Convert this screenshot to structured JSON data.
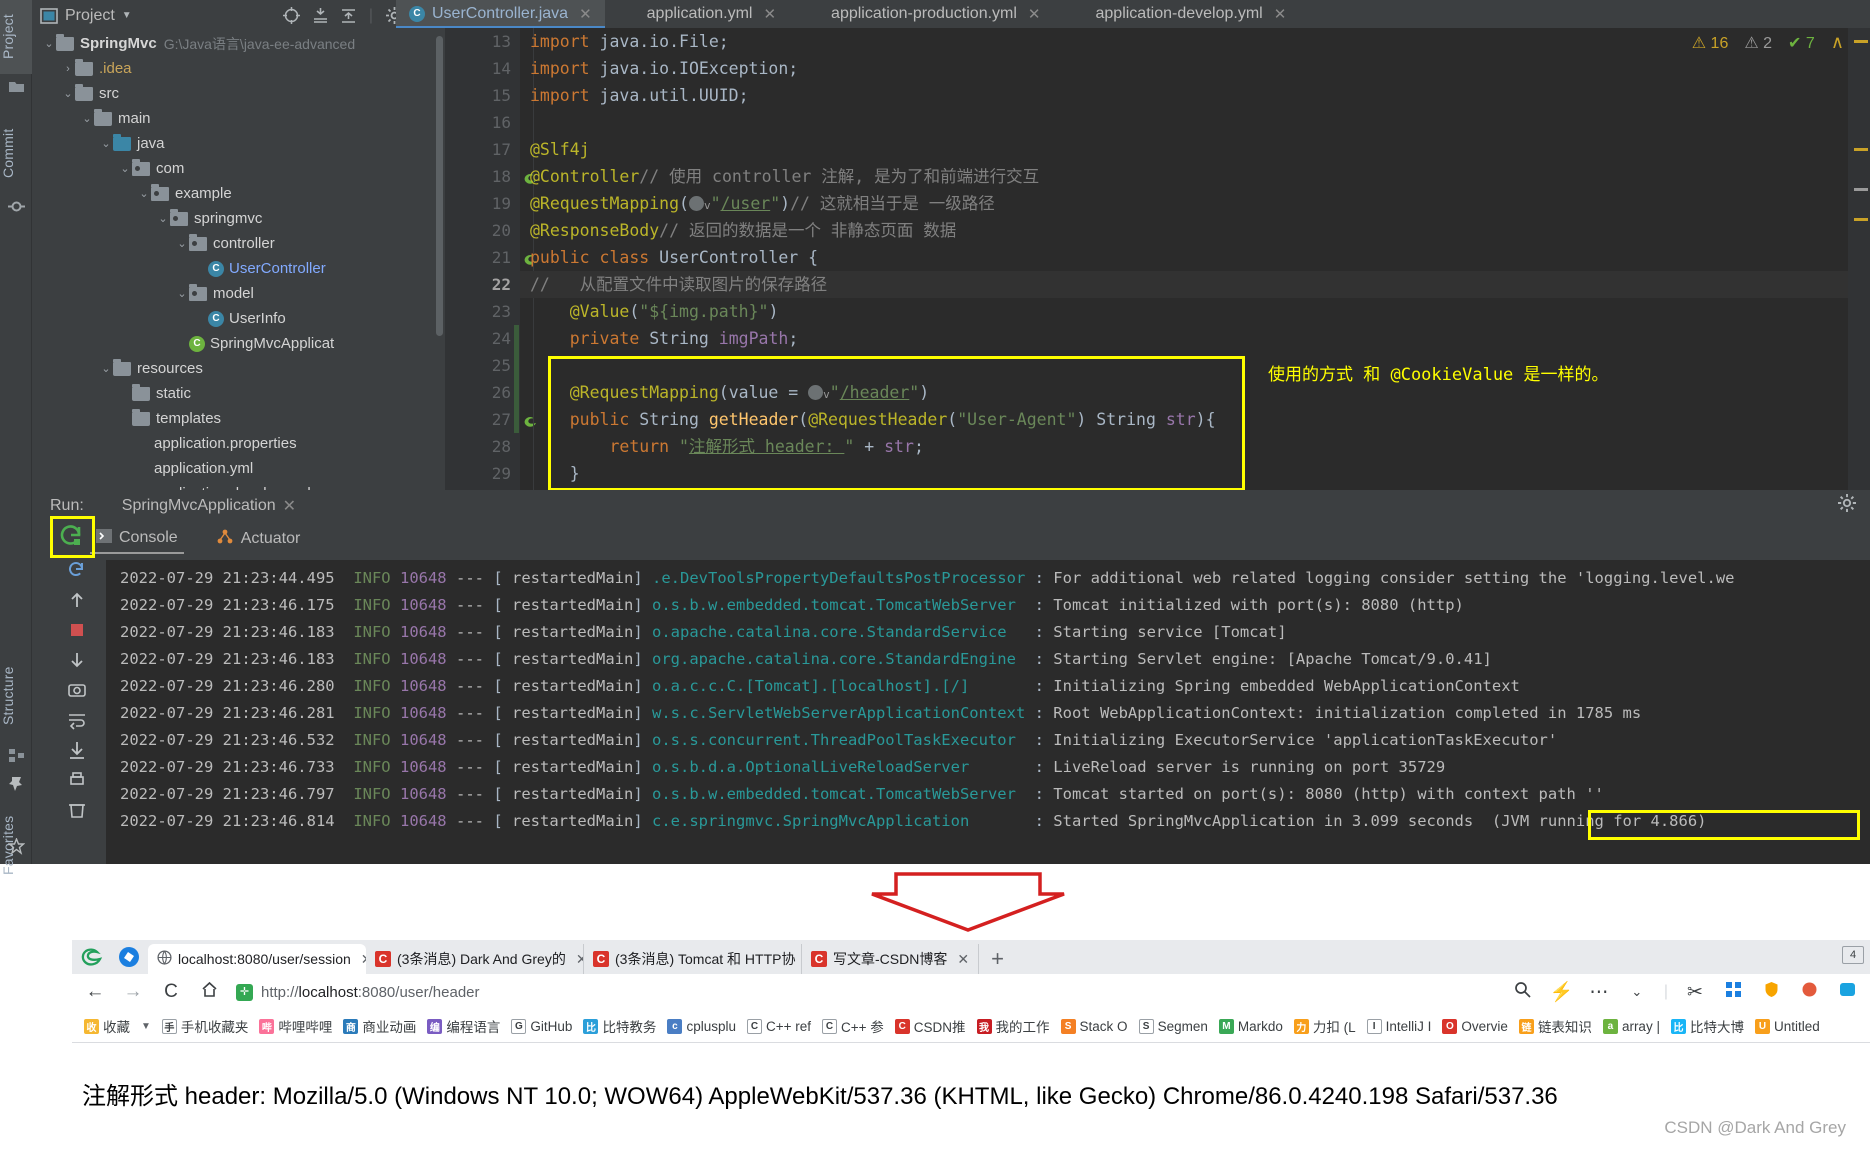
{
  "ide": {
    "left_strip": [
      {
        "label": "Project",
        "name": "tool-window-project",
        "active": true
      },
      {
        "label": "Commit",
        "name": "tool-window-commit",
        "active": false
      },
      {
        "label": "Structure",
        "name": "tool-window-structure",
        "active": false
      },
      {
        "label": "Favorites",
        "name": "tool-window-favorites",
        "active": false
      }
    ],
    "project_panel": {
      "title": "Project",
      "tree": [
        {
          "indent": 0,
          "chev": "v",
          "icon": "folder-module",
          "label": "SpringMvc",
          "bold": true,
          "path": "G:\\Java语言\\java-ee-advanced"
        },
        {
          "indent": 1,
          "chev": ">",
          "icon": "folder",
          "label": ".idea",
          "color": "yellow"
        },
        {
          "indent": 1,
          "chev": "v",
          "icon": "folder",
          "label": "src"
        },
        {
          "indent": 2,
          "chev": "v",
          "icon": "folder",
          "label": "main"
        },
        {
          "indent": 3,
          "chev": "v",
          "icon": "folder-blue",
          "label": "java"
        },
        {
          "indent": 4,
          "chev": "v",
          "icon": "package",
          "label": "com"
        },
        {
          "indent": 5,
          "chev": "v",
          "icon": "package",
          "label": "example"
        },
        {
          "indent": 6,
          "chev": "v",
          "icon": "package",
          "label": "springmvc"
        },
        {
          "indent": 7,
          "chev": "v",
          "icon": "package",
          "label": "controller"
        },
        {
          "indent": 8,
          "chev": "",
          "icon": "class",
          "label": "UserController",
          "color": "blue"
        },
        {
          "indent": 7,
          "chev": "v",
          "icon": "package",
          "label": "model"
        },
        {
          "indent": 8,
          "chev": "",
          "icon": "class",
          "label": "UserInfo"
        },
        {
          "indent": 7,
          "chev": "",
          "icon": "spring-app",
          "label": "SpringMvcApplicat"
        },
        {
          "indent": 3,
          "chev": "v",
          "icon": "folder-res",
          "label": "resources"
        },
        {
          "indent": 4,
          "chev": "",
          "icon": "folder",
          "label": "static"
        },
        {
          "indent": 4,
          "chev": "",
          "icon": "folder",
          "label": "templates"
        },
        {
          "indent": 4,
          "chev": "",
          "icon": "spring-leaf",
          "label": "application.properties"
        },
        {
          "indent": 4,
          "chev": "",
          "icon": "spring-leaf",
          "label": "application.yml"
        },
        {
          "indent": 4,
          "chev": "",
          "icon": "spring-leaf",
          "label": "application-develop.yml"
        }
      ]
    },
    "editor_tabs": [
      {
        "label": "UserController.java",
        "icon": "java-class-icon",
        "active": true
      },
      {
        "label": "application.yml",
        "icon": "spring-leaf-icon",
        "active": false
      },
      {
        "label": "application-production.yml",
        "icon": "spring-leaf-icon",
        "active": false
      },
      {
        "label": "application-develop.yml",
        "icon": "spring-leaf-icon",
        "active": false
      }
    ],
    "inspections": {
      "warnings": "16",
      "weak_warnings": "2",
      "checks": "7"
    },
    "code_lines": [
      {
        "num": "13",
        "marker": "",
        "html": "<span class=\"k\">import</span> java.io.File;",
        "indent": 1
      },
      {
        "num": "14",
        "marker": "",
        "html": "<span class=\"k\">import</span> java.io.IOException;",
        "indent": 1
      },
      {
        "num": "15",
        "marker": "",
        "html": "<span class=\"k\">import</span> java.util.UUID;",
        "indent": 1
      },
      {
        "num": "16",
        "marker": "",
        "html": "",
        "indent": 0
      },
      {
        "num": "17",
        "marker": "",
        "html": "<span class=\"ann\">@Slf4j</span>",
        "indent": 1
      },
      {
        "num": "18",
        "marker": "spring-bean",
        "html": "<span class=\"ann\">@Controller</span><span class=\"cmt\">// 使用 controller 注解, 是为了和前端进行交互</span>",
        "indent": 1
      },
      {
        "num": "19",
        "marker": "",
        "html": "<span class=\"ann\">@RequestMapping</span>(<span class=\"glob\"></span><span class=\"chv\">v</span><span class=\"str\">\"</span><span class=\"lnk\">/user</span><span class=\"str\">\"</span>)<span class=\"cmt\">// 这就相当于是 一级路径</span>",
        "indent": 1
      },
      {
        "num": "20",
        "marker": "",
        "html": "<span class=\"ann\">@ResponseBody</span><span class=\"cmt\">// 返回的数据是一个 非静态页面 数据</span>",
        "indent": 1
      },
      {
        "num": "21",
        "marker": "spring-controller",
        "html": "<span class=\"k\">public class</span> <span class=\"cn\">UserController</span> {",
        "indent": 1
      },
      {
        "num": "22",
        "marker": "",
        "html": "<span class=\"cmt\">//   从配置文件中读取图片的保存路径</span>",
        "indent": 1,
        "highlight": true
      },
      {
        "num": "23",
        "marker": "",
        "html": "    <span class=\"ann\">@Value</span>(<span class=\"str\">\"${img.path}\"</span>)",
        "indent": 1
      },
      {
        "num": "24",
        "marker": "",
        "html": "    <span class=\"k\">private</span> String <span class=\"fld\">imgPath</span>;",
        "indent": 1
      },
      {
        "num": "25",
        "marker": "",
        "html": "",
        "indent": 0
      },
      {
        "num": "26",
        "marker": "",
        "html": "    <span class=\"ann\">@RequestMapping</span>(value = <span class=\"glob\"></span><span class=\"chv\">v</span><span class=\"str\">\"</span><span class=\"lnk\">/header</span><span class=\"str\">\"</span>)",
        "indent": 1
      },
      {
        "num": "27",
        "marker": "spring-controller",
        "html": "    <span class=\"k\">public</span> String <span class=\"mth\">getHeader</span>(<span class=\"ann\">@RequestHeader</span>(<span class=\"str\">\"User-Agent\"</span>) String <span class=\"fld\">str</span>){",
        "indent": 1
      },
      {
        "num": "28",
        "marker": "",
        "html": "        <span class=\"k\">return</span> <span class=\"str\">\"</span><span class=\"lnk\">注解形式 header: </span><span class=\"str\">\"</span> + <span class=\"fld\">str</span>;",
        "indent": 1
      },
      {
        "num": "29",
        "marker": "",
        "html": "    }",
        "indent": 1
      }
    ],
    "editor_note": "使用的方式 和 @CookieValue 是一样的。"
  },
  "run_panel": {
    "run_label": "Run:",
    "config_name": "SpringMvcApplication",
    "tabs": [
      {
        "label": "Console",
        "icon": "console-icon",
        "active": true
      },
      {
        "label": "Actuator",
        "icon": "actuator-icon",
        "active": false
      }
    ],
    "log": [
      {
        "ts": "2022-07-29 21:23:44.495",
        "level": "INFO",
        "pid": "10648",
        "thread": "restartedMain",
        "cls": ".e.DevToolsPropertyDefaultsPostProcessor",
        "msg": "For additional web related logging consider setting the 'logging.level.we"
      },
      {
        "ts": "2022-07-29 21:23:46.175",
        "level": "INFO",
        "pid": "10648",
        "thread": "restartedMain",
        "cls": "o.s.b.w.embedded.tomcat.TomcatWebServer",
        "msg": "Tomcat initialized with port(s): 8080 (http)"
      },
      {
        "ts": "2022-07-29 21:23:46.183",
        "level": "INFO",
        "pid": "10648",
        "thread": "restartedMain",
        "cls": "o.apache.catalina.core.StandardService",
        "msg": "Starting service [Tomcat]"
      },
      {
        "ts": "2022-07-29 21:23:46.183",
        "level": "INFO",
        "pid": "10648",
        "thread": "restartedMain",
        "cls": "org.apache.catalina.core.StandardEngine",
        "msg": "Starting Servlet engine: [Apache Tomcat/9.0.41]"
      },
      {
        "ts": "2022-07-29 21:23:46.280",
        "level": "INFO",
        "pid": "10648",
        "thread": "restartedMain",
        "cls": "o.a.c.c.C.[Tomcat].[localhost].[/]",
        "msg": "Initializing Spring embedded WebApplicationContext"
      },
      {
        "ts": "2022-07-29 21:23:46.281",
        "level": "INFO",
        "pid": "10648",
        "thread": "restartedMain",
        "cls": "w.s.c.ServletWebServerApplicationContext",
        "msg": "Root WebApplicationContext: initialization completed in 1785 ms"
      },
      {
        "ts": "2022-07-29 21:23:46.532",
        "level": "INFO",
        "pid": "10648",
        "thread": "restartedMain",
        "cls": "o.s.s.concurrent.ThreadPoolTaskExecutor",
        "msg": "Initializing ExecutorService 'applicationTaskExecutor'"
      },
      {
        "ts": "2022-07-29 21:23:46.733",
        "level": "INFO",
        "pid": "10648",
        "thread": "restartedMain",
        "cls": "o.s.b.d.a.OptionalLiveReloadServer",
        "msg": "LiveReload server is running on port 35729"
      },
      {
        "ts": "2022-07-29 21:23:46.797",
        "level": "INFO",
        "pid": "10648",
        "thread": "restartedMain",
        "cls": "o.s.b.w.embedded.tomcat.TomcatWebServer",
        "msg": "Tomcat started on port(s): 8080 (http) with context path ''"
      },
      {
        "ts": "2022-07-29 21:23:46.814",
        "level": "INFO",
        "pid": "10648",
        "thread": "restartedMain",
        "cls": "c.e.springmvc.SpringMvcApplication",
        "msg": "Started SpringMvcApplication in 3.099 seconds  (JVM running for 4.866)"
      }
    ]
  },
  "browser": {
    "tabs": [
      {
        "label": "localhost:8080/user/session",
        "favicon": "globe-icon",
        "active": true
      },
      {
        "label": "(3条消息) Dark And Grey的",
        "favicon": "csdn-icon",
        "active": false
      },
      {
        "label": "(3条消息) Tomcat 和 HTTP协",
        "favicon": "csdn-icon",
        "active": false
      },
      {
        "label": "写文章-CSDN博客",
        "favicon": "csdn-icon",
        "active": false
      }
    ],
    "new_tab_label": "+",
    "window_count": "4",
    "nav": {
      "back": "←",
      "forward": "→",
      "reload": "C",
      "home": "⌂"
    },
    "url_scheme": "http://",
    "url_host": "localhost",
    "url_rest": ":8080/user/header",
    "toolbar_icons": [
      "search-icon",
      "lightning-icon",
      "more-icon",
      "chevron-down-icon",
      "cut-icon",
      "grid-icon",
      "shield-icon",
      "paint-icon",
      "collections-icon"
    ],
    "bookmarks": [
      {
        "label": "收藏",
        "icon": "star-icon",
        "color": "#f5b731"
      },
      {
        "label": "手机收藏夹",
        "icon": "phone-icon",
        "color": "#ffffff"
      },
      {
        "label": "哔哩哔哩",
        "icon": "bilibili-icon",
        "color": "#fb7299"
      },
      {
        "label": "商业动画",
        "icon": "folder-icon",
        "color": "#2b7bba"
      },
      {
        "label": "编程语言",
        "icon": "code-icon",
        "color": "#7a5cc2"
      },
      {
        "label": "GitHub",
        "icon": "github-icon",
        "color": "#ffffff"
      },
      {
        "label": "比特教务",
        "icon": "flag-icon",
        "color": "#2b9fd9"
      },
      {
        "label": "cplusplu",
        "icon": "cpp-icon",
        "color": "#4a7ec4"
      },
      {
        "label": "C++ ref",
        "icon": "globe-icon",
        "color": "#ffffff"
      },
      {
        "label": "C++ 参",
        "icon": "globe-icon",
        "color": "#ffffff"
      },
      {
        "label": "CSDN推",
        "icon": "csdn-icon",
        "color": "#d9342b"
      },
      {
        "label": "我的工作",
        "icon": "gitee-icon",
        "color": "#c71d23"
      },
      {
        "label": "Stack O",
        "icon": "stack-icon",
        "color": "#f48024"
      },
      {
        "label": "Segmen",
        "icon": "globe-icon",
        "color": "#ffffff"
      },
      {
        "label": "Markdo",
        "icon": "markdown-icon",
        "color": "#3aa856"
      },
      {
        "label": "力扣 (L",
        "icon": "leetcode-icon",
        "color": "#f89f1b"
      },
      {
        "label": "IntelliJ I",
        "icon": "globe-icon",
        "color": "#ffffff"
      },
      {
        "label": "Overvie",
        "icon": "record-icon",
        "color": "#d9342b"
      },
      {
        "label": "链表知识",
        "icon": "leetcode-icon",
        "color": "#f89f1b"
      },
      {
        "label": "array |",
        "icon": "leaf-icon",
        "color": "#6db33f"
      },
      {
        "label": "比特大博",
        "icon": "calendar-icon",
        "color": "#19b5f6"
      },
      {
        "label": "Untitled",
        "icon": "notion-icon",
        "color": "#f89f1b"
      }
    ],
    "page_text": "注解形式 header: Mozilla/5.0 (Windows NT 10.0; WOW64) AppleWebKit/537.36 (KHTML, like Gecko) Chrome/86.0.4240.198 Safari/537.36"
  },
  "watermark": "CSDN @Dark And Grey",
  "colors": {
    "accent_yellow": "#ffff00",
    "ide_bg": "#3c3f41",
    "editor_bg": "#2b2b2b",
    "arrow_red": "#d42020"
  }
}
